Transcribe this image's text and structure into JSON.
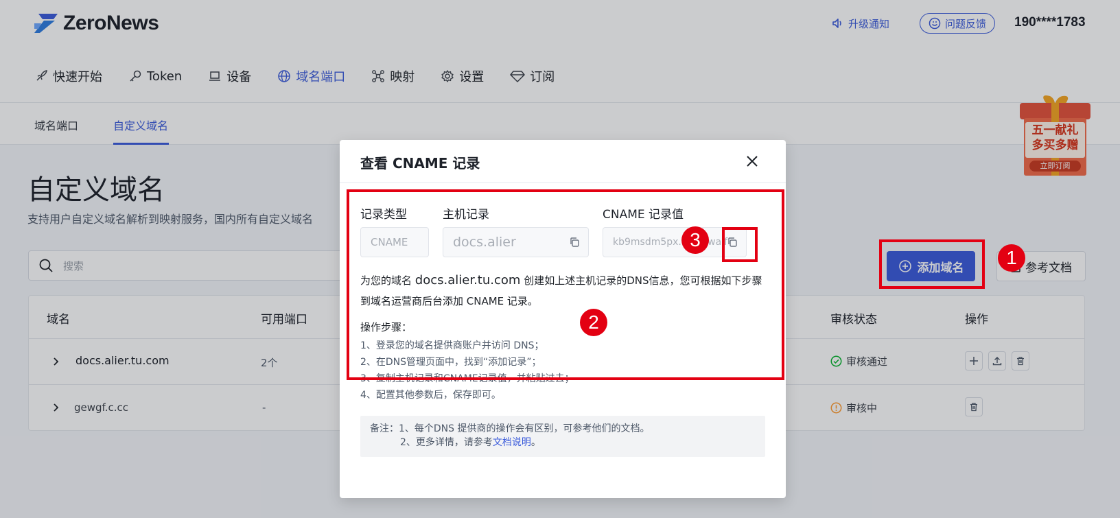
{
  "header": {
    "brand": "ZeroNews",
    "notify_label": "升级通知",
    "feedback_label": "问题反馈",
    "phone": "190****1783"
  },
  "nav": [
    {
      "label": "快速开始",
      "icon": "rocket-icon"
    },
    {
      "label": "Token",
      "icon": "key-icon"
    },
    {
      "label": "设备",
      "icon": "laptop-icon"
    },
    {
      "label": "域名端口",
      "icon": "globe-icon",
      "active": true
    },
    {
      "label": "映射",
      "icon": "network-icon"
    },
    {
      "label": "设置",
      "icon": "gear-icon"
    },
    {
      "label": "订阅",
      "icon": "diamond-icon"
    }
  ],
  "subtabs": [
    {
      "label": "域名端口"
    },
    {
      "label": "自定义域名",
      "active": true
    }
  ],
  "page": {
    "title": "自定义域名",
    "description": "支持用户自定义域名解析到映射服务，国内所有自定义域名"
  },
  "search": {
    "placeholder": "搜索"
  },
  "buttons": {
    "add_domain": "添加域名",
    "ref_docs": "参考文档"
  },
  "table": {
    "headers": {
      "domain": "域名",
      "ports": "可用端口",
      "review": "审核状态",
      "ops": "操作"
    },
    "rows": [
      {
        "domain": "docs.alier.tu.com",
        "ports": "2个",
        "status": "审核通过",
        "status_color": "#00b42a"
      },
      {
        "domain": "gewgf.c.cc",
        "ports": "-",
        "status": "审核中",
        "status_color": "#ff9a2e"
      }
    ]
  },
  "promo": {
    "line1": "五一献礼",
    "line2": "多买多赠",
    "cta": "立即订阅"
  },
  "modal": {
    "title": "查看 CNAME 记录",
    "labels": {
      "type": "记录类型",
      "host": "主机记录",
      "value": "CNAME 记录值"
    },
    "values": {
      "type": "CNAME",
      "host": "docs.alier",
      "value": "kb9msdm5px.c...st.waif"
    },
    "desc_prefix": "为您的域名",
    "desc_domain": "docs.alier.tu.com",
    "desc_suffix": "创建如上述主机记录的DNS信息，您可根据如下步骤到域名运营商后台添加 CNAME 记录。",
    "steps_title": "操作步骤：",
    "steps": [
      "1、登录您的域名提供商账户并访问 DNS；",
      "2、在DNS管理页面中，找到“添加记录”；",
      "3、复制主机记录和CNAME记录值，并粘贴过去；",
      "4、配置其他参数后，保存即可。"
    ],
    "note_line1": "备注：1、每个DNS 提供商的操作会有区别，可参考他们的文档。",
    "note_line2_prefix": "2、更多详情，请参考",
    "note_link": "文档说明",
    "note_line2_suffix": "。"
  },
  "annotations": {
    "b1": "1",
    "b2": "2",
    "b3": "3"
  },
  "colors": {
    "accent": "#3b5bdb",
    "annotation_red": "#e30012"
  }
}
